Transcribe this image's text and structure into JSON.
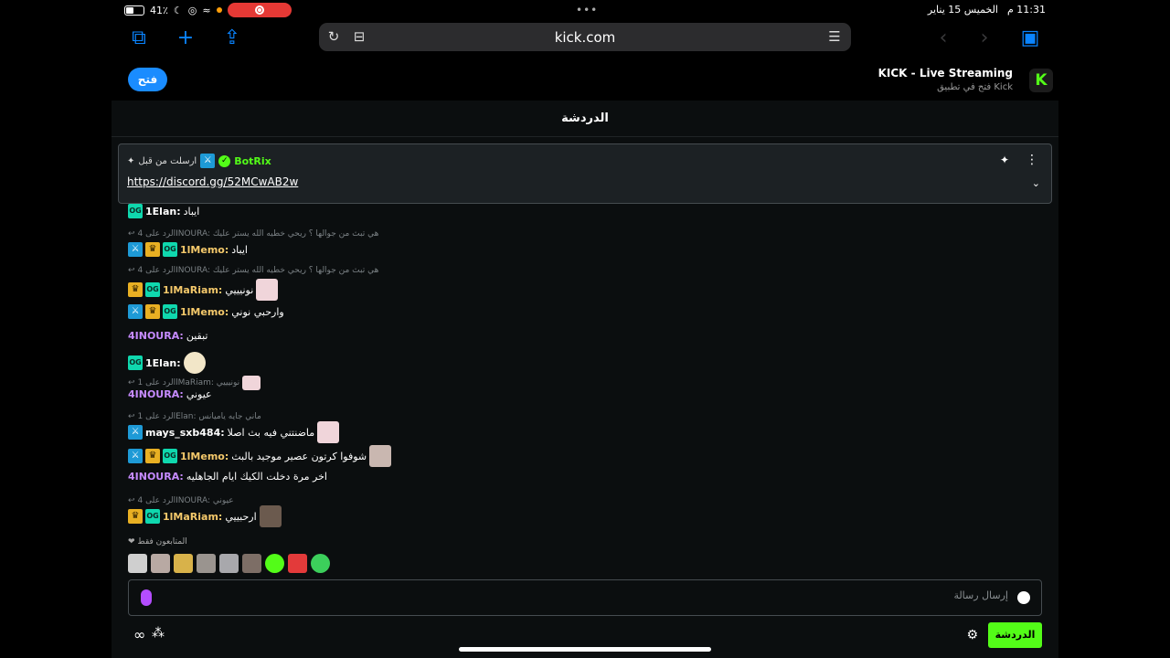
{
  "status_bar": {
    "time": "11:31 م",
    "date": "الخميس 15 يناير",
    "battery": "41٪"
  },
  "browser": {
    "url": "kick.com"
  },
  "banner": {
    "title": "KICK - Live Streaming",
    "subtitle": "فتح في تطبيق Kick",
    "open_label": "فتح"
  },
  "chat": {
    "header": "الدردشة",
    "pinned": {
      "author": "BotRix",
      "meta": "ارسلت من قبل",
      "link": "https://discord.gg/52MCwAB2w"
    },
    "messages": [
      {
        "user": "1Elan:",
        "text": "ايباد"
      },
      {
        "reply": "الرد على 4INOURA: هي تبث من جوالها ؟ ريحي خطيه الله يستر عليك"
      },
      {
        "user": "1lMemo:",
        "text": "ايباد"
      },
      {
        "reply": "الرد على 4INOURA: هي تبث من جوالها ؟ ريحي خطيه الله يستر عليك"
      },
      {
        "user": "1lMaRiam:",
        "text": "نونيييي"
      },
      {
        "user": "1lMemo:",
        "text": "وارحبي نوني"
      },
      {
        "user": "4INOURA:",
        "text": "تبقين"
      },
      {
        "user": "1Elan:",
        "text": ""
      },
      {
        "reply": "الرد على 1lMaRiam: نونيييي"
      },
      {
        "user": "4INOURA:",
        "text": "عيوني"
      },
      {
        "reply": "الرد على 1Elan: ماني جايه ياميانس"
      },
      {
        "user": "mays_sxb484:",
        "text": "ماضنتني فيه بث اصلا"
      },
      {
        "user": "1lMemo:",
        "text": "شوفوا كرتون عصير موجيد بالبث"
      },
      {
        "user": "4INOURA:",
        "text": "اخر مرة دخلت الكيك ايام الجاهليه"
      },
      {
        "reply": "الرد على 4INOURA: عيوني"
      },
      {
        "user": "1lMaRiam:",
        "text": "ارحبييي"
      }
    ],
    "followers_only": "المتابعون فقط",
    "input_placeholder": "إرسال رسالة",
    "send_label": "الدردشة"
  },
  "colors": {
    "kick_green": "#53fc18",
    "user_memo": "#f5c96b",
    "user_mariam": "#f5c96b",
    "user_elan": "#ffffff",
    "user_inoura": "#c68bff",
    "user_mays": "#ffffff"
  }
}
